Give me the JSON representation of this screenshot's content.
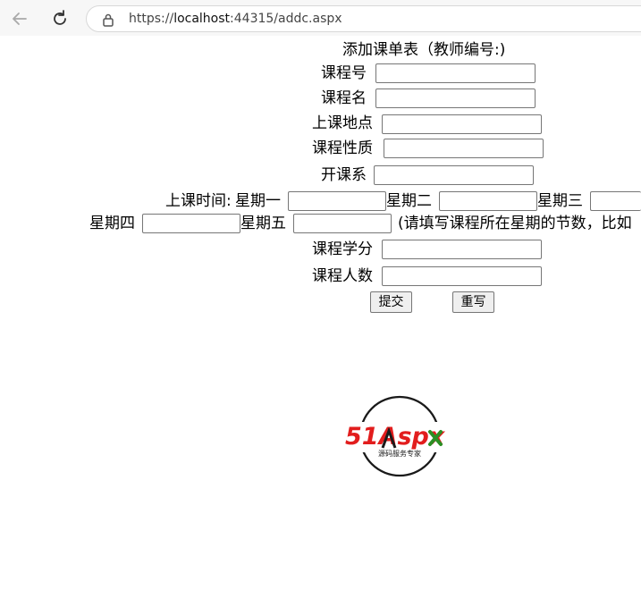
{
  "browser": {
    "url_prefix": "https://",
    "url_host": "localhost",
    "url_suffix": ":44315/addc.aspx"
  },
  "form": {
    "title": "添加课单表（教师编号:)",
    "course_number_label": "课程号",
    "course_name_label": "课程名",
    "classroom_label": "上课地点",
    "course_type_label": "课程性质",
    "department_label": "开课系",
    "time_label": "上课时间:",
    "monday_label": "星期一",
    "tuesday_label": "星期二",
    "wednesday_label": "星期三",
    "thursday_label": "星期四",
    "friday_label": "星期五",
    "hint": "(请填写课程所在星期的节数，比如",
    "credit_label": "课程学分",
    "capacity_label": "课程人数",
    "submit_label": "提交",
    "reset_label": "重写"
  },
  "logo": {
    "brand": "51Aspx",
    "subtitle": "源码服务专家",
    "colors": {
      "red": "#e21d1d",
      "green": "#2a8f24",
      "dark": "#1a1a1a"
    }
  },
  "icons": {
    "back": "back-arrow-icon",
    "reload": "reload-icon",
    "lock": "lock-icon"
  }
}
